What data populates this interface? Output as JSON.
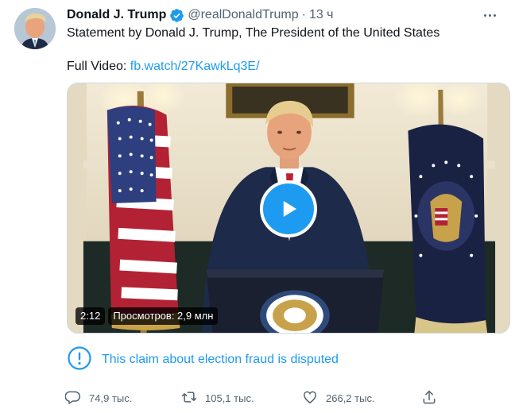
{
  "tweet": {
    "author_name": "Donald J. Trump",
    "handle": "@realDonaldTrump",
    "separator": "·",
    "time": "13 ч",
    "text_line1": "Statement by Donald J. Trump, The President of the United States",
    "text_prefix": "Full Video: ",
    "link_text": "fb.watch/27KawkLq3E/"
  },
  "media": {
    "duration": "2:12",
    "views": "Просмотров: 2,9 млн"
  },
  "notice": {
    "text": "This claim about election fraud is disputed"
  },
  "actions": {
    "replies": "74,9 тыс.",
    "retweets": "105,1 тыс.",
    "likes": "266,2 тыс."
  },
  "icons": {
    "verified": "verified-badge-icon",
    "more": "more-icon",
    "play": "play-icon",
    "info": "info-icon",
    "reply": "reply-icon",
    "retweet": "retweet-icon",
    "like": "heart-icon",
    "share": "share-icon"
  },
  "colors": {
    "accent": "#1d9bf0",
    "secondary_text": "#536471"
  }
}
